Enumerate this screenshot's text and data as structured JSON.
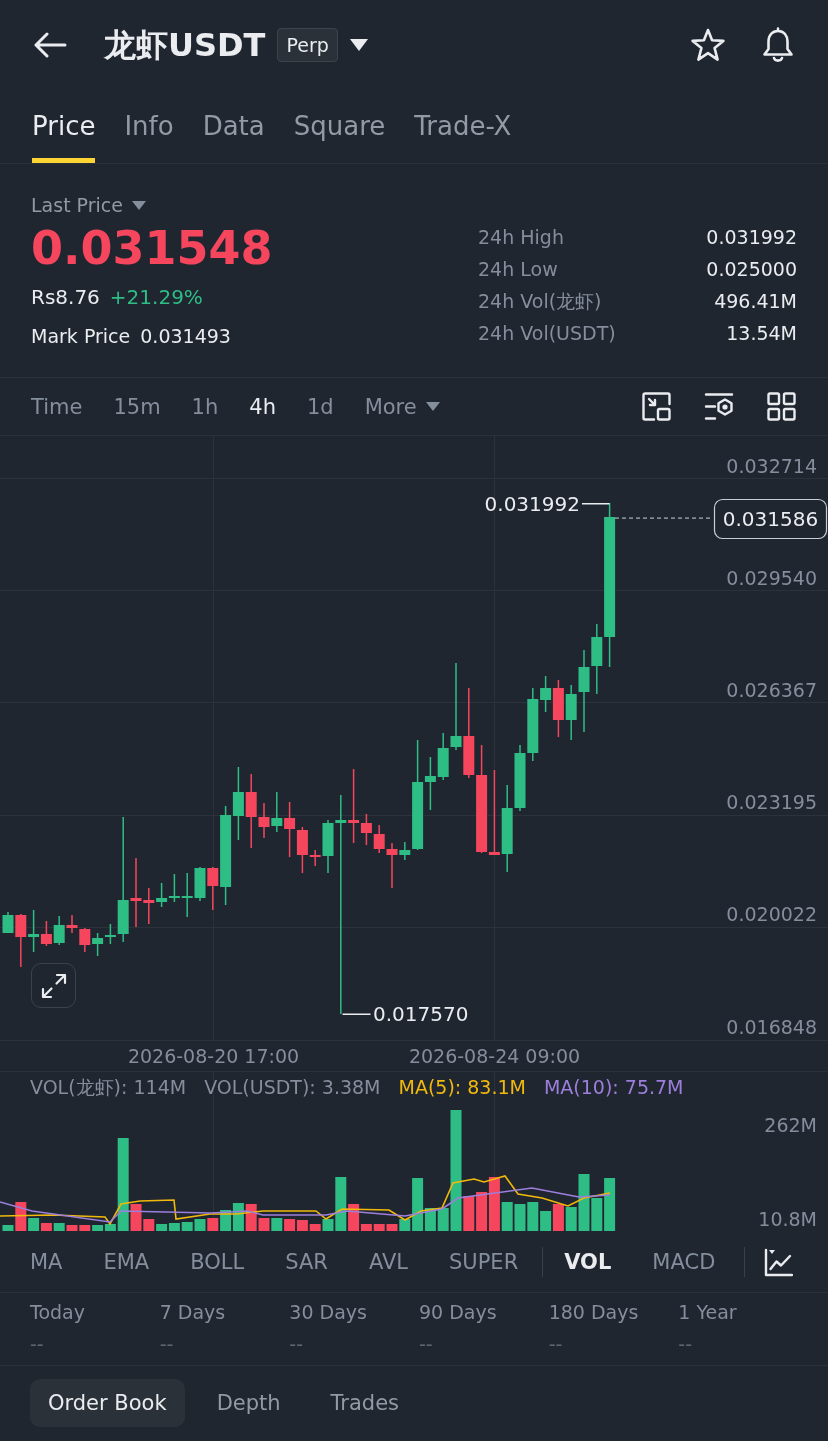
{
  "header": {
    "symbol": "龙虾USDT",
    "badge": "Perp"
  },
  "tabs": [
    {
      "label": "Price",
      "selected": true
    },
    {
      "label": "Info",
      "selected": false
    },
    {
      "label": "Data",
      "selected": false
    },
    {
      "label": "Square",
      "selected": false
    },
    {
      "label": "Trade-X",
      "selected": false
    }
  ],
  "price_panel": {
    "selector": "Last Price",
    "last_price": "0.031548",
    "last_price_rising": false,
    "fiat_price": "Rs8.76",
    "change": "+21.29%",
    "change_rising": true,
    "mark_price_label": "Mark Price",
    "mark_price": "0.031493",
    "stats": [
      {
        "label": "24h High",
        "value": "0.031992"
      },
      {
        "label": "24h Low",
        "value": "0.025000"
      },
      {
        "label": "24h Vol(龙虾)",
        "value": "496.41M"
      },
      {
        "label": "24h Vol(USDT)",
        "value": "13.54M"
      }
    ]
  },
  "intervals": [
    {
      "label": "Time",
      "kind": "option",
      "selected": false
    },
    {
      "label": "15m",
      "kind": "option",
      "selected": false
    },
    {
      "label": "1h",
      "kind": "option",
      "selected": false
    },
    {
      "label": "4h",
      "kind": "option",
      "selected": true
    },
    {
      "label": "1d",
      "kind": "option",
      "selected": false
    },
    {
      "label": "More",
      "kind": "menu",
      "selected": false
    }
  ],
  "chart": {
    "price_ticks": [
      "0.032714",
      "0.029540",
      "0.026367",
      "0.023195",
      "0.020022",
      "0.016848"
    ],
    "high_label": "0.031992",
    "low_label": "0.017570",
    "current_price": "0.031586",
    "time_labels": [
      "2026-08-20 17:00",
      "2026-08-24 09:00"
    ]
  },
  "volume": {
    "legend": [
      {
        "text": "VOL(龙虾): 114M",
        "color": "#848e9c"
      },
      {
        "text": "VOL(USDT): 3.38M",
        "color": "#848e9c"
      },
      {
        "text": "MA(5): 83.1M",
        "color": "#f0b90b"
      },
      {
        "text": "MA(10): 75.7M",
        "color": "#9c7fdc"
      }
    ],
    "axis_labels": [
      "262M",
      "10.8M"
    ]
  },
  "indicators": {
    "main": [
      {
        "label": "MA",
        "selected": false
      },
      {
        "label": "EMA",
        "selected": false
      },
      {
        "label": "BOLL",
        "selected": false
      },
      {
        "label": "SAR",
        "selected": false
      },
      {
        "label": "AVL",
        "selected": false
      },
      {
        "label": "SUPER",
        "selected": false
      }
    ],
    "sub": [
      {
        "label": "VOL",
        "selected": true
      },
      {
        "label": "MACD",
        "selected": false
      }
    ]
  },
  "performance": [
    {
      "period": "Today",
      "value": "--"
    },
    {
      "period": "7 Days",
      "value": "--"
    },
    {
      "period": "30 Days",
      "value": "--"
    },
    {
      "period": "90 Days",
      "value": "--"
    },
    {
      "period": "180 Days",
      "value": "--"
    },
    {
      "period": "1 Year",
      "value": "--"
    }
  ],
  "bottom_tabs": [
    {
      "label": "Order Book",
      "selected": true
    },
    {
      "label": "Depth",
      "selected": false
    },
    {
      "label": "Trades",
      "selected": false
    }
  ]
}
